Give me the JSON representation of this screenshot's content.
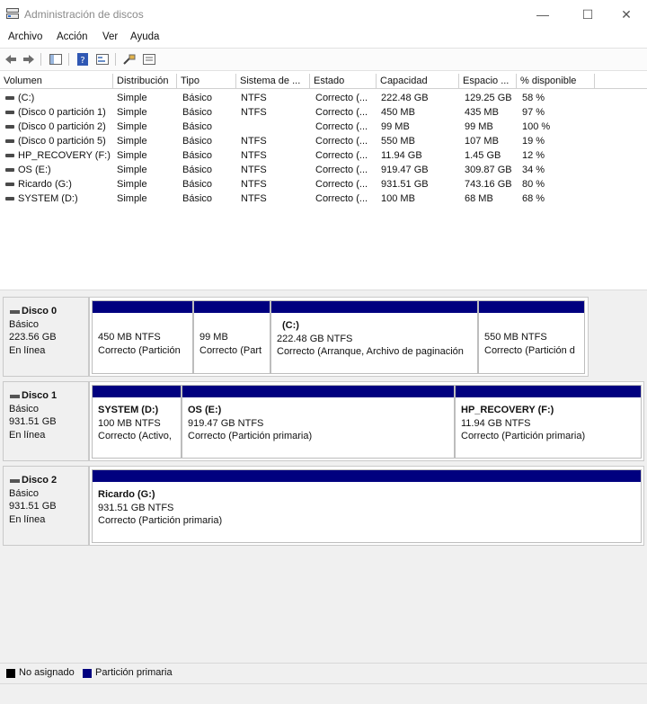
{
  "window": {
    "title": "Administración de discos",
    "min": "—",
    "max": "☐",
    "close": "✕"
  },
  "menu": [
    "Archivo",
    "Acción",
    "Ver",
    "Ayuda"
  ],
  "columns": [
    "Volumen",
    "Distribución",
    "Tipo",
    "Sistema de ...",
    "Estado",
    "Capacidad",
    "Espacio ...",
    "% disponible"
  ],
  "volumes": [
    [
      "(C:)",
      "Simple",
      "Básico",
      "NTFS",
      "Correcto (...",
      "222.48 GB",
      "129.25 GB",
      "58 %"
    ],
    [
      "(Disco 0 partición 1)",
      "Simple",
      "Básico",
      "NTFS",
      "Correcto (...",
      "450 MB",
      "435 MB",
      "97 %"
    ],
    [
      "(Disco 0 partición 2)",
      "Simple",
      "Básico",
      "",
      "Correcto (...",
      "99 MB",
      "99 MB",
      "100 %"
    ],
    [
      "(Disco 0 partición 5)",
      "Simple",
      "Básico",
      "NTFS",
      "Correcto (...",
      "550 MB",
      "107 MB",
      "19 %"
    ],
    [
      "HP_RECOVERY (F:)",
      "Simple",
      "Básico",
      "NTFS",
      "Correcto (...",
      "11.94 GB",
      "1.45 GB",
      "12 %"
    ],
    [
      "OS (E:)",
      "Simple",
      "Básico",
      "NTFS",
      "Correcto (...",
      "919.47 GB",
      "309.87 GB",
      "34 %"
    ],
    [
      "Ricardo (G:)",
      "Simple",
      "Básico",
      "NTFS",
      "Correcto (...",
      "931.51 GB",
      "743.16 GB",
      "80 %"
    ],
    [
      "SYSTEM (D:)",
      "Simple",
      "Básico",
      "NTFS",
      "Correcto (...",
      "100 MB",
      "68 MB",
      "68 %"
    ]
  ],
  "disks": [
    {
      "name": "Disco 0",
      "type": "Básico",
      "size": "223.56 GB",
      "status": "En línea",
      "partitions": [
        {
          "name": "",
          "size": "450 MB NTFS",
          "status": "Correcto (Partición"
        },
        {
          "name": "",
          "size": "99 MB",
          "status": "Correcto (Part"
        },
        {
          "name": "(C:)",
          "size": "222.48 GB NTFS",
          "status": "Correcto (Arranque, Archivo de paginación"
        },
        {
          "name": "",
          "size": "550 MB NTFS",
          "status": "Correcto (Partición d"
        }
      ]
    },
    {
      "name": "Disco 1",
      "type": "Básico",
      "size": "931.51 GB",
      "status": "En línea",
      "partitions": [
        {
          "name": "SYSTEM (D:)",
          "size": "100 MB NTFS",
          "status": "Correcto (Activo,"
        },
        {
          "name": "OS (E:)",
          "size": "919.47 GB NTFS",
          "status": "Correcto (Partición primaria)"
        },
        {
          "name": "HP_RECOVERY (F:)",
          "size": "11.94 GB NTFS",
          "status": "Correcto (Partición primaria)"
        }
      ]
    },
    {
      "name": "Disco 2",
      "type": "Básico",
      "size": "931.51 GB",
      "status": "En línea",
      "partitions": [
        {
          "name": "Ricardo (G:)",
          "size": "931.51 GB NTFS",
          "status": "Correcto (Partición primaria)"
        }
      ]
    }
  ],
  "legend": [
    {
      "label": "No asignado",
      "color": "#000000"
    },
    {
      "label": "Partición primaria",
      "color": "#00007f"
    }
  ]
}
